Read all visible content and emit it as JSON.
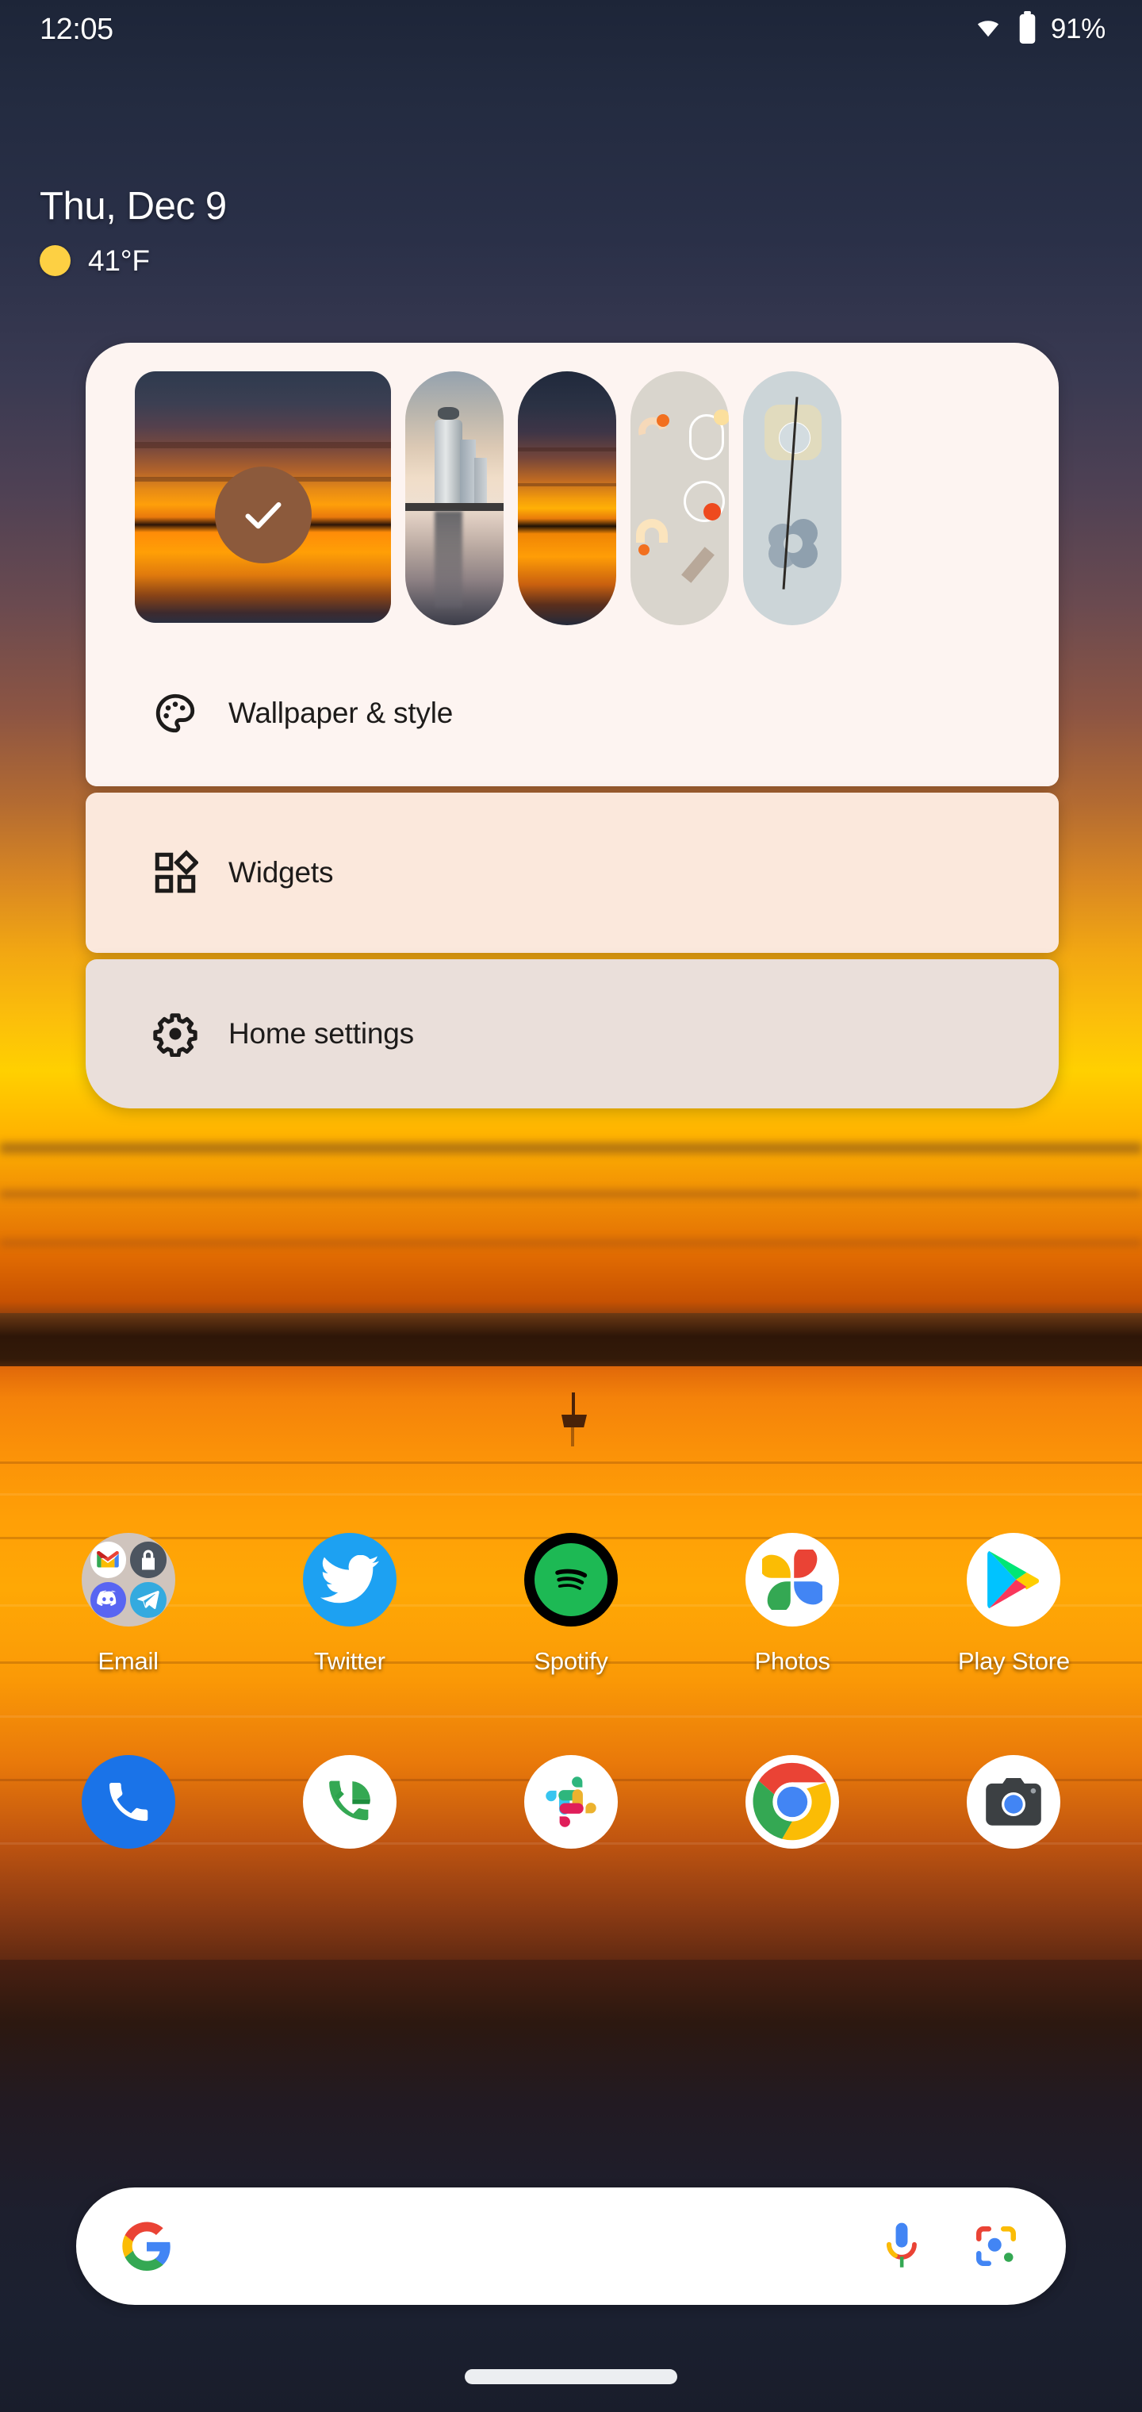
{
  "status_bar": {
    "time": "12:05",
    "battery_percent": "91%",
    "wifi_icon": "wifi-icon",
    "battery_icon": "battery-icon"
  },
  "date_widget": {
    "date": "Thu, Dec 9",
    "temperature": "41°F",
    "weather_icon": "sunny-icon",
    "weather_icon_color": "#fdd043"
  },
  "popup_menu": {
    "wallpaper_previews": [
      {
        "name": "sunset-over-water",
        "selected": true,
        "check_icon": "check-icon",
        "check_bg": "#8c5a3c"
      },
      {
        "name": "city-skyline-reflection",
        "selected": false
      },
      {
        "name": "sunset-over-water-alt",
        "selected": false
      },
      {
        "name": "abstract-shapes-beige",
        "selected": false
      },
      {
        "name": "abstract-flower-blue",
        "selected": false
      }
    ],
    "items": [
      {
        "label": "Wallpaper & style",
        "icon": "palette-icon",
        "bg": "#fdf4f1"
      },
      {
        "label": "Widgets",
        "icon": "widgets-icon",
        "bg": "#fbe8dc"
      },
      {
        "label": "Home settings",
        "icon": "gear-icon",
        "bg": "#eadfda"
      }
    ]
  },
  "app_grid": {
    "row1": [
      {
        "label": "Email",
        "icon": "email-folder-icon",
        "folder_apps": [
          "gmail-icon",
          "protonmail-icon",
          "discord-icon",
          "telegram-icon"
        ]
      },
      {
        "label": "Twitter",
        "icon": "twitter-icon"
      },
      {
        "label": "Spotify",
        "icon": "spotify-icon"
      },
      {
        "label": "Photos",
        "icon": "google-photos-icon"
      },
      {
        "label": "Play Store",
        "icon": "play-store-icon"
      }
    ],
    "row2": [
      {
        "label": "",
        "icon": "phone-icon"
      },
      {
        "label": "",
        "icon": "google-voice-icon"
      },
      {
        "label": "",
        "icon": "slack-icon"
      },
      {
        "label": "",
        "icon": "chrome-icon"
      },
      {
        "label": "",
        "icon": "camera-icon"
      }
    ]
  },
  "search_bar": {
    "placeholder": "",
    "value": "",
    "google_icon": "google-g-icon",
    "mic_icon": "microphone-icon",
    "lens_icon": "google-lens-icon"
  },
  "navigation": {
    "gesture_pill": "home-gesture-pill"
  }
}
